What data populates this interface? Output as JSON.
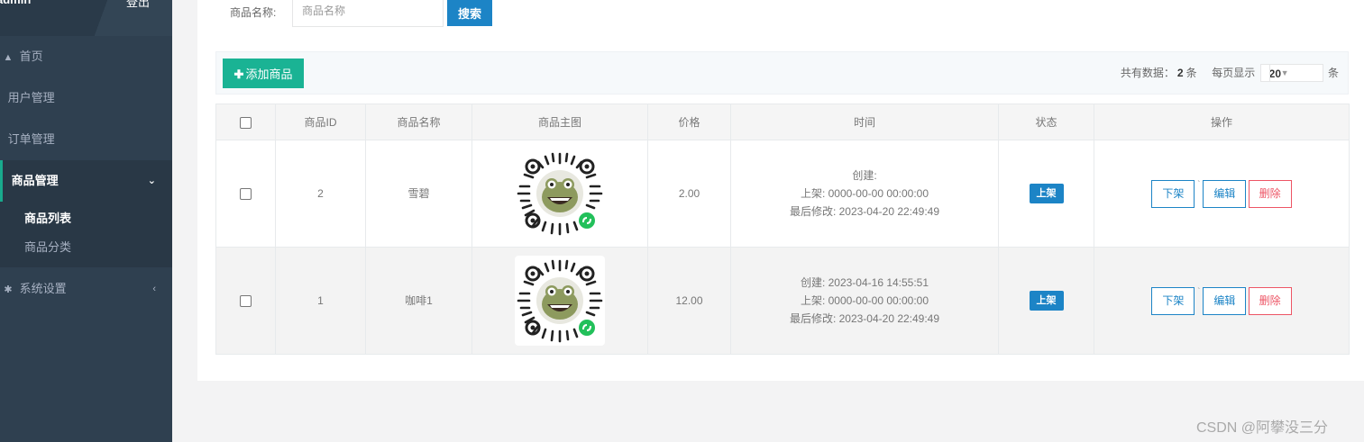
{
  "sidebar": {
    "username": "admin",
    "logout": "登出",
    "items": [
      {
        "label": "首页",
        "icon": "home-icon"
      },
      {
        "label": "用户管理"
      },
      {
        "label": "订单管理"
      },
      {
        "label": "商品管理",
        "icon": "chevron-down-icon"
      },
      {
        "label": "系统设置",
        "icon": "gear-icon"
      }
    ],
    "sub_items": [
      {
        "label": "商品列表"
      },
      {
        "label": "商品分类"
      }
    ]
  },
  "search": {
    "label": "商品名称:",
    "placeholder": "商品名称",
    "button": "搜索"
  },
  "toolbar": {
    "add_button": "添加商品",
    "total_prefix": "共有数据：",
    "total_count": "2",
    "total_suffix": "条",
    "per_page_prefix": "每页显示",
    "per_page_value": "20",
    "per_page_suffix": "条"
  },
  "table": {
    "columns": [
      "商品ID",
      "商品名称",
      "商品主图",
      "价格",
      "时间",
      "状态",
      "操作"
    ],
    "rows": [
      {
        "id": "2",
        "name": "雪碧",
        "price": "2.00",
        "created": "创建:",
        "listed": "上架: 0000-00-00 00:00:00",
        "modified": "最后修改: 2023-04-20 22:49:49",
        "status": "上架",
        "actions": [
          "下架",
          "编辑",
          "删除"
        ]
      },
      {
        "id": "1",
        "name": "咖啡1",
        "price": "12.00",
        "created": "创建: 2023-04-16 14:55:51",
        "listed": "上架: 0000-00-00 00:00:00",
        "modified": "最后修改: 2023-04-20 22:49:49",
        "status": "上架",
        "actions": [
          "下架",
          "编辑",
          "删除"
        ]
      }
    ]
  },
  "watermark": "CSDN @阿攀没三分",
  "colors": {
    "sidebar_bg": "#2f4050",
    "primary": "#1c84c6",
    "success": "#1ab394",
    "danger": "#ed5565"
  }
}
